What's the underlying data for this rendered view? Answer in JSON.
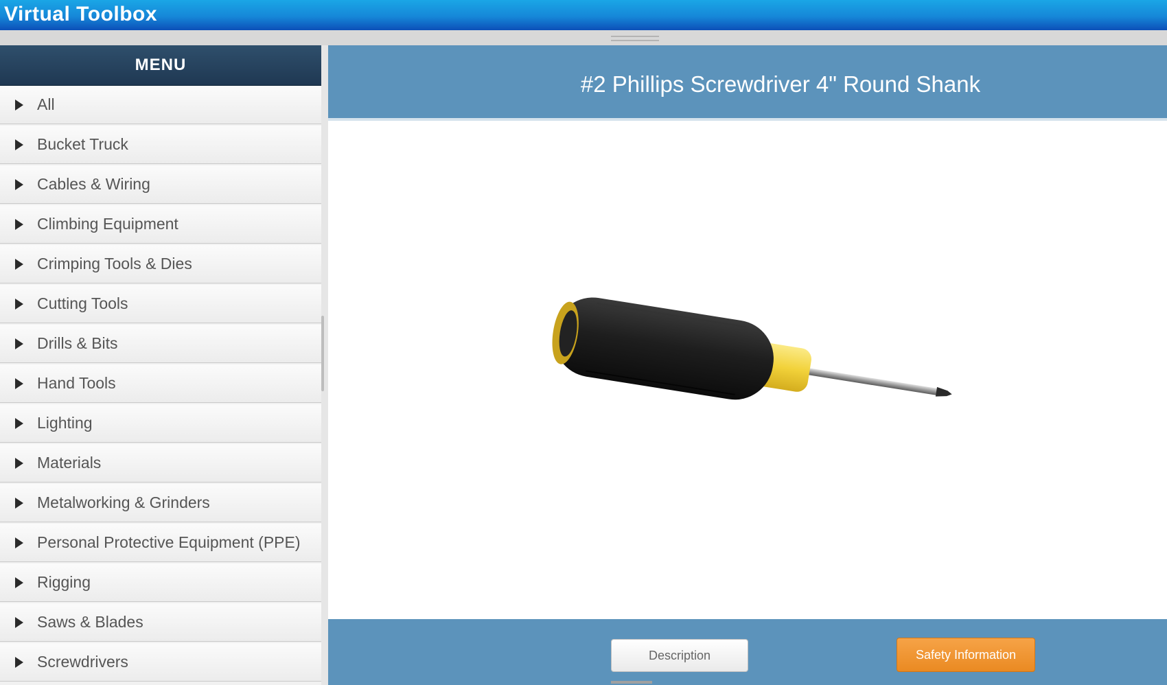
{
  "window": {
    "title": "Virtual Toolbox"
  },
  "sidebar": {
    "header": "MENU",
    "items": [
      {
        "label": "All"
      },
      {
        "label": "Bucket Truck"
      },
      {
        "label": "Cables & Wiring"
      },
      {
        "label": "Climbing Equipment"
      },
      {
        "label": "Crimping Tools & Dies"
      },
      {
        "label": "Cutting Tools"
      },
      {
        "label": "Drills & Bits"
      },
      {
        "label": "Hand Tools"
      },
      {
        "label": "Lighting"
      },
      {
        "label": "Materials"
      },
      {
        "label": "Metalworking & Grinders"
      },
      {
        "label": "Personal Protective Equipment (PPE)"
      },
      {
        "label": "Rigging"
      },
      {
        "label": "Saws & Blades"
      },
      {
        "label": "Screwdrivers"
      }
    ]
  },
  "main": {
    "tool_title": "#2 Phillips Screwdriver 4\" Round Shank",
    "image_icon": "screwdriver-icon",
    "description_button": "Description",
    "safety_button": "Safety Information"
  },
  "colors": {
    "titlebar": "#1687d8",
    "panel_blue": "#5c93bb",
    "menu_header": "#2f4f6c",
    "safety_orange": "#ea8a22",
    "handle_black": "#1e1e1e",
    "handle_yellow": "#f2d23a"
  }
}
